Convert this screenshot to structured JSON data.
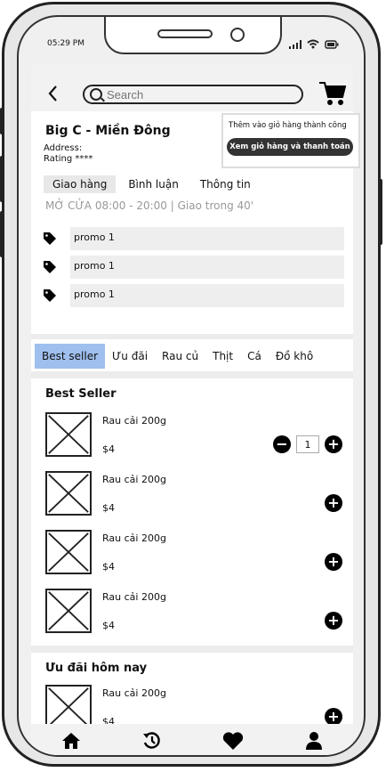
{
  "status_bar": {
    "time": "05:29 PM"
  },
  "header": {
    "search_placeholder": "Search"
  },
  "toast": {
    "message": "Thêm vào giỏ hàng thành công",
    "action": "Xem giỏ hàng và thanh toán"
  },
  "store": {
    "name": "Big C - Miền Đông",
    "address_label": "Address:",
    "rating_label": "Rating ****",
    "tabs": [
      "Giao hàng",
      "Bình luận",
      "Thông tin"
    ],
    "hours": "MỞ CỬA 08:00 - 20:00 | Giao trong 40'",
    "promos": [
      "promo 1",
      "promo 1",
      "promo 1"
    ]
  },
  "categories": [
    "Best seller",
    "Ưu đãi",
    "Rau củ",
    "Thịt",
    "Cá",
    "Đồ khô"
  ],
  "sections": [
    {
      "title": "Best Seller",
      "products": [
        {
          "name": "Rau cải 200g",
          "price": "$4",
          "qty": "1"
        },
        {
          "name": "Rau cải 200g",
          "price": "$4"
        },
        {
          "name": "Rau cải 200g",
          "price": "$4"
        },
        {
          "name": "Rau cải 200g",
          "price": "$4"
        }
      ]
    },
    {
      "title": "Ưu đãi hôm nay",
      "products": [
        {
          "name": "Rau cải 200g",
          "price": "$4"
        }
      ]
    }
  ],
  "nav": [
    "home-icon",
    "history-icon",
    "heart-icon",
    "user-icon"
  ]
}
